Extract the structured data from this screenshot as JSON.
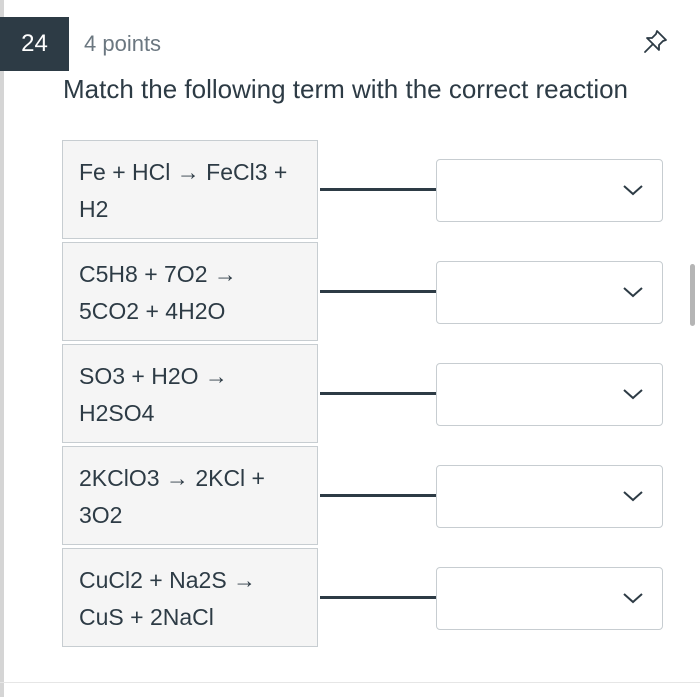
{
  "question": {
    "number": "24",
    "points": "4 points",
    "prompt": "Match the following term with the correct reaction"
  },
  "icons": {
    "pin": "pushpin-icon",
    "dropdown": "chevron-down-icon"
  },
  "colors": {
    "text": "#2d3b45",
    "badge_bg": "#2d3b45",
    "muted": "#6b7780",
    "border": "#c7cdd1"
  },
  "matches": [
    {
      "line1": "Fe + HCl → FeCl3 +",
      "line2": "H2",
      "selected": ""
    },
    {
      "line1": "C5H8 + 7O2 →",
      "line2": "5CO2 + 4H2O",
      "selected": ""
    },
    {
      "line1": "SO3 + H2O →",
      "line2": "H2SO4",
      "selected": ""
    },
    {
      "line1": "2KClO3 → 2KCl +",
      "line2": "3O2",
      "selected": ""
    },
    {
      "line1": "CuCl2 + Na2S →",
      "line2": "CuS + 2NaCl",
      "selected": ""
    }
  ]
}
